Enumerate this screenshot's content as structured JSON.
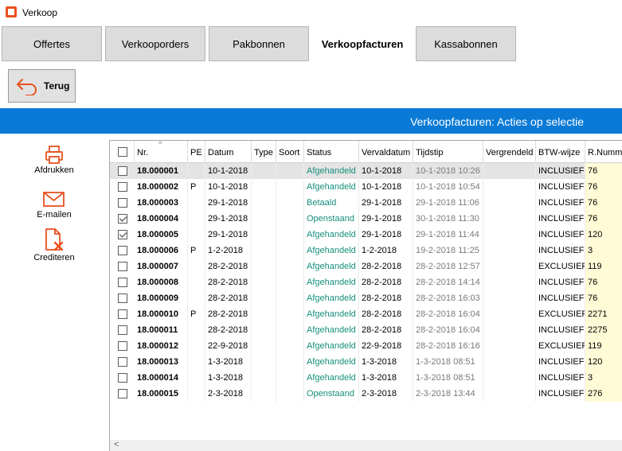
{
  "window": {
    "title": "Verkoop"
  },
  "tabs": [
    {
      "label": "Offertes",
      "active": false
    },
    {
      "label": "Verkooporders",
      "active": false
    },
    {
      "label": "Pakbonnen",
      "active": false
    },
    {
      "label": "Verkoopfacturen",
      "active": true
    },
    {
      "label": "Kassabonnen",
      "active": false
    }
  ],
  "back_button": {
    "label": "Terug",
    "icon": "back-arrow-icon"
  },
  "selection_bar": {
    "title": "Verkoopfacturen: Acties op selectie",
    "color": "#0a7ad6"
  },
  "actions": [
    {
      "label": "Afdrukken",
      "icon": "printer-icon"
    },
    {
      "label": "E-mailen",
      "icon": "envelope-icon"
    },
    {
      "label": "Crediteren",
      "icon": "credit-document-icon"
    }
  ],
  "accent_color": "#e8511e",
  "status_color": "#168f7c",
  "table": {
    "columns": [
      "Nr.",
      "PE",
      "Datum",
      "Type",
      "Soort",
      "Status",
      "Vervaldatum",
      "Tijdstip",
      "Vergrendeld",
      "BTW-wijze",
      "R.Nummer"
    ],
    "sorted_column": "Nr.",
    "rows": [
      {
        "checked": false,
        "selected": true,
        "nr": "18.000001",
        "pe": "",
        "datum": "10-1-2018",
        "type": "",
        "soort": "",
        "status": "Afgehandeld",
        "vervaldatum": "10-1-2018",
        "tijdstip": "10-1-2018 10:26",
        "vergrendeld": "",
        "btw": "INCLUSIEF",
        "rnummer": "76"
      },
      {
        "checked": false,
        "selected": false,
        "nr": "18.000002",
        "pe": "P",
        "datum": "10-1-2018",
        "type": "",
        "soort": "",
        "status": "Afgehandeld",
        "vervaldatum": "10-1-2018",
        "tijdstip": "10-1-2018 10:54",
        "vergrendeld": "",
        "btw": "INCLUSIEF",
        "rnummer": "76"
      },
      {
        "checked": false,
        "selected": false,
        "nr": "18.000003",
        "pe": "",
        "datum": "29-1-2018",
        "type": "",
        "soort": "",
        "status": "Betaald",
        "vervaldatum": "29-1-2018",
        "tijdstip": "29-1-2018 11:06",
        "vergrendeld": "",
        "btw": "INCLUSIEF",
        "rnummer": "76"
      },
      {
        "checked": true,
        "selected": false,
        "nr": "18.000004",
        "pe": "",
        "datum": "29-1-2018",
        "type": "",
        "soort": "",
        "status": "Openstaand",
        "vervaldatum": "29-1-2018",
        "tijdstip": "30-1-2018 11:30",
        "vergrendeld": "",
        "btw": "INCLUSIEF",
        "rnummer": "76"
      },
      {
        "checked": true,
        "selected": false,
        "nr": "18.000005",
        "pe": "",
        "datum": "29-1-2018",
        "type": "",
        "soort": "",
        "status": "Afgehandeld",
        "vervaldatum": "29-1-2018",
        "tijdstip": "29-1-2018 11:44",
        "vergrendeld": "",
        "btw": "INCLUSIEF",
        "rnummer": "120"
      },
      {
        "checked": false,
        "selected": false,
        "nr": "18.000006",
        "pe": "P",
        "datum": "1-2-2018",
        "type": "",
        "soort": "",
        "status": "Afgehandeld",
        "vervaldatum": "1-2-2018",
        "tijdstip": "19-2-2018 11:25",
        "vergrendeld": "",
        "btw": "INCLUSIEF",
        "rnummer": "3"
      },
      {
        "checked": false,
        "selected": false,
        "nr": "18.000007",
        "pe": "",
        "datum": "28-2-2018",
        "type": "",
        "soort": "",
        "status": "Afgehandeld",
        "vervaldatum": "28-2-2018",
        "tijdstip": "28-2-2018 12:57",
        "vergrendeld": "",
        "btw": "EXCLUSIEF",
        "rnummer": "119"
      },
      {
        "checked": false,
        "selected": false,
        "nr": "18.000008",
        "pe": "",
        "datum": "28-2-2018",
        "type": "",
        "soort": "",
        "status": "Afgehandeld",
        "vervaldatum": "28-2-2018",
        "tijdstip": "28-2-2018 14:14",
        "vergrendeld": "",
        "btw": "INCLUSIEF",
        "rnummer": "76"
      },
      {
        "checked": false,
        "selected": false,
        "nr": "18.000009",
        "pe": "",
        "datum": "28-2-2018",
        "type": "",
        "soort": "",
        "status": "Afgehandeld",
        "vervaldatum": "28-2-2018",
        "tijdstip": "28-2-2018 16:03",
        "vergrendeld": "",
        "btw": "INCLUSIEF",
        "rnummer": "76"
      },
      {
        "checked": false,
        "selected": false,
        "nr": "18.000010",
        "pe": "P",
        "datum": "28-2-2018",
        "type": "",
        "soort": "",
        "status": "Afgehandeld",
        "vervaldatum": "28-2-2018",
        "tijdstip": "28-2-2018 16:04",
        "vergrendeld": "",
        "btw": "EXCLUSIEF",
        "rnummer": "2271"
      },
      {
        "checked": false,
        "selected": false,
        "nr": "18.000011",
        "pe": "",
        "datum": "28-2-2018",
        "type": "",
        "soort": "",
        "status": "Afgehandeld",
        "vervaldatum": "28-2-2018",
        "tijdstip": "28-2-2018 16:04",
        "vergrendeld": "",
        "btw": "INCLUSIEF",
        "rnummer": "2275"
      },
      {
        "checked": false,
        "selected": false,
        "nr": "18.000012",
        "pe": "",
        "datum": "22-9-2018",
        "type": "",
        "soort": "",
        "status": "Afgehandeld",
        "vervaldatum": "22-9-2018",
        "tijdstip": "28-2-2018 16:16",
        "vergrendeld": "",
        "btw": "EXCLUSIEF",
        "rnummer": "119"
      },
      {
        "checked": false,
        "selected": false,
        "nr": "18.000013",
        "pe": "",
        "datum": "1-3-2018",
        "type": "",
        "soort": "",
        "status": "Afgehandeld",
        "vervaldatum": "1-3-2018",
        "tijdstip": "1-3-2018 08:51",
        "vergrendeld": "",
        "btw": "INCLUSIEF",
        "rnummer": "120"
      },
      {
        "checked": false,
        "selected": false,
        "nr": "18.000014",
        "pe": "",
        "datum": "1-3-2018",
        "type": "",
        "soort": "",
        "status": "Afgehandeld",
        "vervaldatum": "1-3-2018",
        "tijdstip": "1-3-2018 08:51",
        "vergrendeld": "",
        "btw": "INCLUSIEF",
        "rnummer": "3"
      },
      {
        "checked": false,
        "selected": false,
        "nr": "18.000015",
        "pe": "",
        "datum": "2-3-2018",
        "type": "",
        "soort": "",
        "status": "Openstaand",
        "vervaldatum": "2-3-2018",
        "tijdstip": "2-3-2018 13:44",
        "vergrendeld": "",
        "btw": "INCLUSIEF",
        "rnummer": "276"
      }
    ]
  }
}
